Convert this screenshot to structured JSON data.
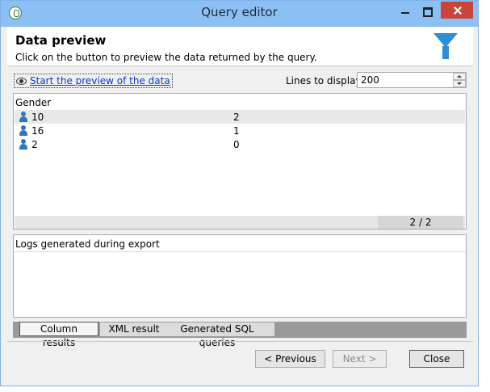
{
  "window": {
    "title": "Query editor"
  },
  "header": {
    "title": "Data preview",
    "subtitle": "Click on the button to preview the data returned by the query."
  },
  "preview": {
    "link_label": "Start the preview of the data",
    "lines_label": "Lines to display:",
    "lines_value": "200"
  },
  "grid": {
    "column": "Gender",
    "rows": [
      {
        "value": "10",
        "count": "2"
      },
      {
        "value": "16",
        "count": "1"
      },
      {
        "value": "2",
        "count": "0"
      }
    ],
    "page": "2 / 2"
  },
  "logs": {
    "title": "Logs generated during export"
  },
  "tabs": [
    {
      "label": "Column results",
      "active": true
    },
    {
      "label": "XML result",
      "active": false
    },
    {
      "label": "Generated SQL queries",
      "active": false
    }
  ],
  "buttons": {
    "previous": "< Previous",
    "next": "Next >",
    "close": "Close"
  },
  "colors": {
    "titlebar": "#8cc0f5",
    "accent": "#2f8fd6",
    "link": "#0a3bc7",
    "close_button": "#c9443a"
  }
}
